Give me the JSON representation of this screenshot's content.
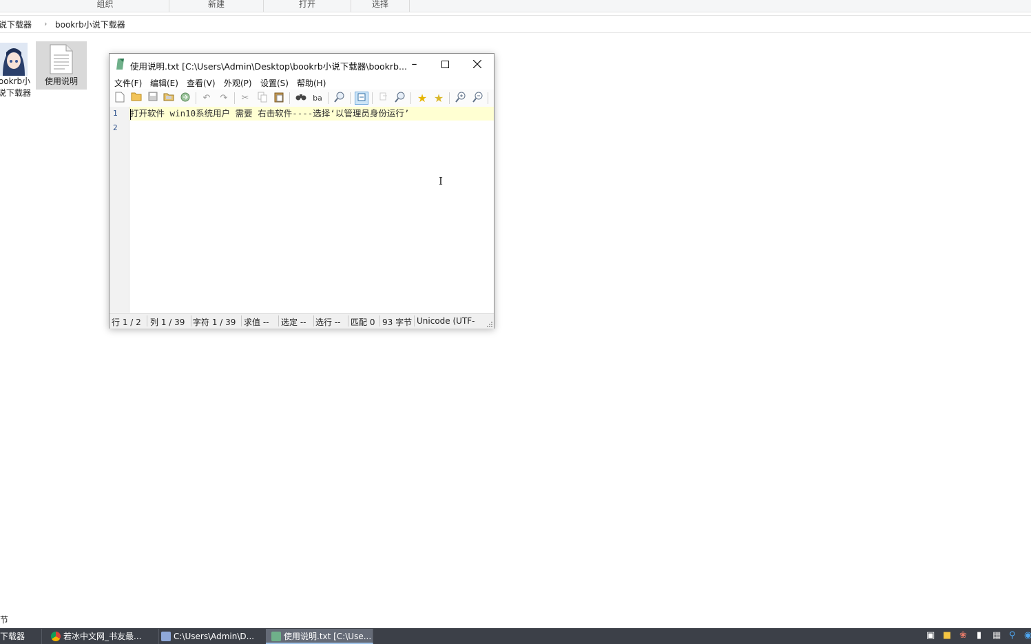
{
  "explorer": {
    "ribbon_groups": [
      "组织",
      "新建",
      "打开",
      "选择"
    ],
    "breadcrumb": [
      "小说下载器",
      "bookrb小说下载器"
    ],
    "files": [
      {
        "label_line1": "ookrb小",
        "label_line2": "说下载器",
        "icon": "anime-avatar-exe-icon"
      },
      {
        "label_line1": "使用说明",
        "label_line2": "",
        "icon": "text-document-icon"
      }
    ],
    "status_text": "节"
  },
  "notepad": {
    "title": "使用说明.txt [C:\\Users\\Admin\\Desktop\\bookrb小说下载器\\bookrb...",
    "menu": [
      "文件(F)",
      "编辑(E)",
      "查看(V)",
      "外观(P)",
      "设置(S)",
      "帮助(H)"
    ],
    "toolbar_icons": [
      "new-file-icon",
      "open-folder-icon",
      "save-icon",
      "save-as-icon",
      "browse-icon",
      "undo-icon",
      "redo-icon",
      "cut-icon",
      "copy-icon",
      "paste-icon",
      "find-icon",
      "replace-icon",
      "find-in-files-icon",
      "word-wrap-icon",
      "view-whitespace-icon",
      "zoom-search-icon",
      "favorites-icon",
      "add-favorite-icon",
      "zoom-in-icon",
      "zoom-out-icon"
    ],
    "lines": [
      {
        "num": "1",
        "text": "打开软件 win10系统用户 需要 右击软件----选择‘以管理员身份运行’"
      },
      {
        "num": "2",
        "text": ""
      }
    ],
    "status": {
      "line": "行  1 / 2",
      "col": "列  1 / 39",
      "char": "字符  1 / 39",
      "eval": "求值  --",
      "sel": "选定  --",
      "sel_lines": "选行  --",
      "match": "匹配  0",
      "bytes": "93 字节",
      "encoding": "Unicode (UTF-"
    }
  },
  "taskbar": {
    "items": [
      {
        "label": "下载器",
        "icon": "folder-icon",
        "active": false
      },
      {
        "label": "若冰中文网_书友最...",
        "icon": "chrome-icon",
        "active": false
      },
      {
        "label": "C:\\Users\\Admin\\D...",
        "icon": "app-icon",
        "active": false
      },
      {
        "label": "使用说明.txt [C:\\Use...",
        "icon": "notepad-icon",
        "active": true
      }
    ]
  }
}
